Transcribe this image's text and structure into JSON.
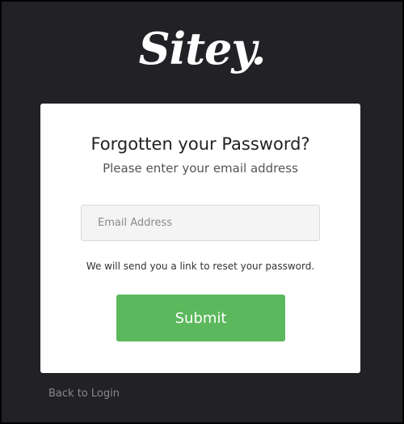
{
  "logo": {
    "text": "Sitey."
  },
  "form": {
    "title": "Forgotten your Password?",
    "subtitle": "Please enter your email address",
    "email_placeholder": "Email Address",
    "email_value": "",
    "note": "We will send you a link to reset your password.",
    "submit_label": "Submit"
  },
  "footer": {
    "back_link_label": "Back to Login"
  },
  "colors": {
    "background": "#222226",
    "card": "#ffffff",
    "submit": "#5cb85c"
  }
}
